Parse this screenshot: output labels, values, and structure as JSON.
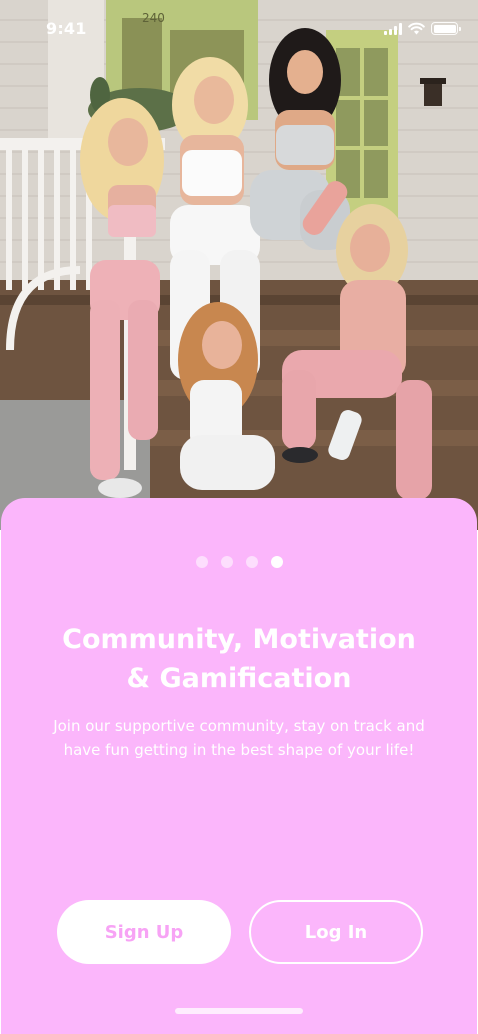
{
  "status_bar": {
    "time": "9:41",
    "icons": [
      "signal-icon",
      "wifi-icon",
      "battery-icon"
    ]
  },
  "hero": {
    "house_number": "240",
    "icon": "photo-of-women-on-porch-steps"
  },
  "onboarding": {
    "pager": {
      "total": 4,
      "active_index": 3
    },
    "title_line1": "Community, Motivation",
    "title_line2": "& Gamification",
    "body": "Join our supportive community, stay on track and have fun getting in the best shape of your life!",
    "signup_label": "Sign Up",
    "login_label": "Log In"
  },
  "colors": {
    "sheet_background": "#fbb6fb",
    "signup_text": "#f7a3f5",
    "white": "#ffffff"
  }
}
